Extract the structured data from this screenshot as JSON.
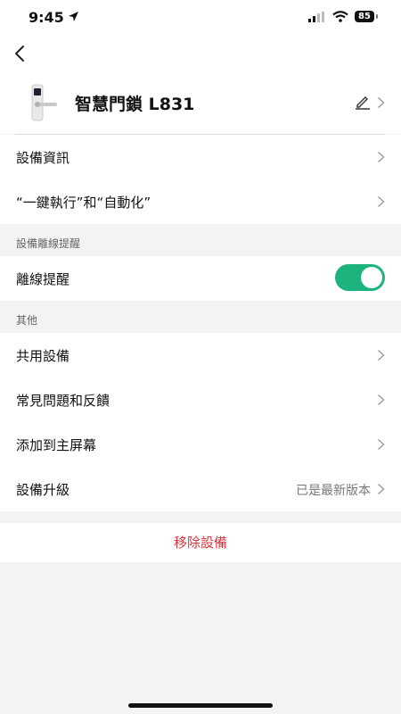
{
  "status_bar": {
    "time": "9:45",
    "battery": "85"
  },
  "device": {
    "name": "智慧門鎖 L831"
  },
  "rows_top": [
    {
      "label": "設備資訊"
    },
    {
      "label": "“一鍵執行”和“自動化”"
    }
  ],
  "offline_section": {
    "title": "設備離線提醒",
    "row_label": "離線提醒",
    "toggle_on": true
  },
  "other_section": {
    "title": "其他",
    "items": [
      {
        "label": "共用設備"
      },
      {
        "label": "常見問題和反饋"
      },
      {
        "label": "添加到主屏幕"
      },
      {
        "label": "設備升級",
        "value": "已是最新版本"
      }
    ]
  },
  "remove_label": "移除設備",
  "colors": {
    "accent_green": "#1cb37c",
    "danger_red": "#d9363e"
  }
}
